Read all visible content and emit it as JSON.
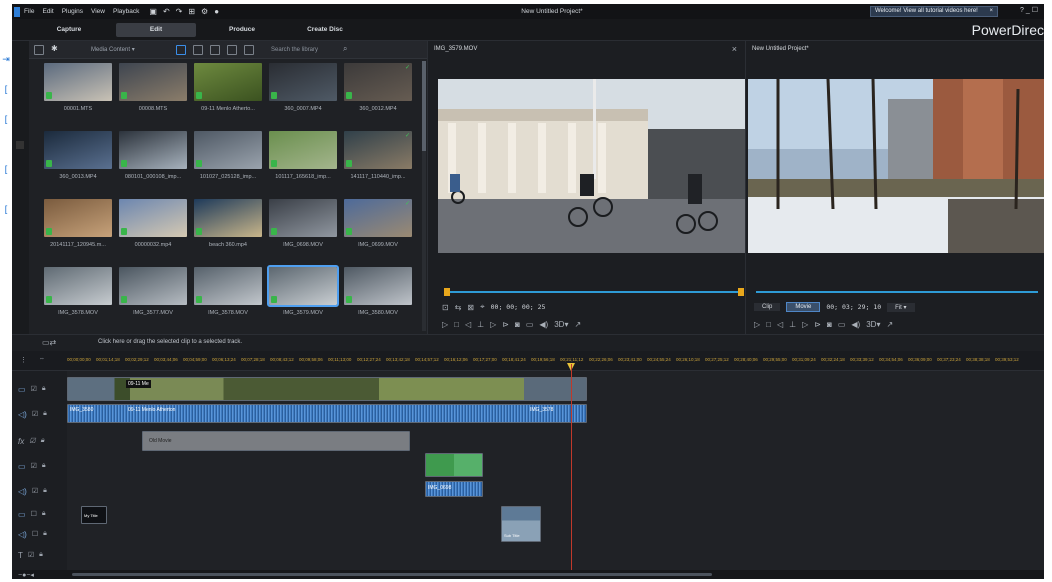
{
  "menu": {
    "items": [
      "File",
      "Edit",
      "Plugins",
      "View",
      "Playback"
    ],
    "window_title": "New Untitled Project*",
    "welcome": "Welcome! View all tutorial videos here!",
    "window_controls": "? _ ☐"
  },
  "modes": [
    "Capture",
    "Edit",
    "Produce",
    "Create Disc"
  ],
  "brand": "PowerDirec",
  "library": {
    "dropdown": "Media Content",
    "search_placeholder": "Search the library",
    "items": [
      {
        "label": "00001.MTS",
        "colors": [
          "#5b6a7e",
          "#c9c2b5"
        ]
      },
      {
        "label": "00008.MTS",
        "colors": [
          "#3e4550",
          "#8b7d6a"
        ]
      },
      {
        "label": "09-11 Menlo Atherto...",
        "colors": [
          "#6e8a3f",
          "#3b5220"
        ]
      },
      {
        "label": "360_0007.MP4",
        "colors": [
          "#2a2d33",
          "#4f5a66"
        ]
      },
      {
        "label": "360_0012.MP4",
        "colors": [
          "#3c3a3a",
          "#665c52"
        ]
      },
      {
        "label": "360_0013.MP4",
        "colors": [
          "#1b2a3c",
          "#5a7090"
        ]
      },
      {
        "label": "080101_000108_imp...",
        "colors": [
          "#2c333c",
          "#a7b2bd"
        ]
      },
      {
        "label": "101027_025128_imp...",
        "colors": [
          "#4e5864",
          "#9aa3ad"
        ]
      },
      {
        "label": "101117_165618_imp...",
        "colors": [
          "#6a8f4e",
          "#a4b58d"
        ]
      },
      {
        "label": "141117_110440_imp...",
        "colors": [
          "#30404a",
          "#8a7b66"
        ]
      },
      {
        "label": "20141117_120945.m...",
        "colors": [
          "#7a5b3e",
          "#c7a27a"
        ]
      },
      {
        "label": "00000032.mp4",
        "colors": [
          "#6c86b0",
          "#d5c9b2"
        ]
      },
      {
        "label": "beach 360.mp4",
        "colors": [
          "#1e3a5a",
          "#c9b68a"
        ]
      },
      {
        "label": "IMG_0698.MOV",
        "colors": [
          "#3a3f47",
          "#9097a0"
        ]
      },
      {
        "label": "IMG_0699.MOV",
        "colors": [
          "#4d6a9a",
          "#9b8a72"
        ]
      },
      {
        "label": "IMG_3578.MOV",
        "colors": [
          "#5f6a73",
          "#c7ccd0"
        ]
      },
      {
        "label": "IMG_3577.MOV",
        "colors": [
          "#4b5660",
          "#b6bcc2"
        ]
      },
      {
        "label": "IMG_3578.MOV",
        "colors": [
          "#56616b",
          "#c2c7cc"
        ]
      },
      {
        "label": "IMG_3579.MOV",
        "colors": [
          "#5c6770",
          "#c9ced2"
        ]
      },
      {
        "label": "IMG_3580.MOV",
        "colors": [
          "#4f5963",
          "#bfc4ca"
        ]
      }
    ]
  },
  "preview_left": {
    "title": "IMG_3579.MOV",
    "timecode": "00; 00; 00; 25"
  },
  "preview_right": {
    "title": "New Untitled Project*",
    "seg_clip": "Clip",
    "seg_movie": "Movie",
    "timecode": "00; 03; 29; 10",
    "fit": "Fit"
  },
  "timeline": {
    "hint": "Click here or drag the selected clip to a selected track.",
    "ruler": [
      "00;00;00;00",
      "00;01;14;18",
      "00;02;29;12",
      "00;03;44;06",
      "00;04;59;00",
      "00;06;13;24",
      "00;07;28;18",
      "00;08;43;12",
      "00;09;58;06",
      "00;11;13;00",
      "00;12;27;24",
      "00;13;42;18",
      "00;14;57;12",
      "00;16;12;06",
      "00;17;27;00",
      "00;18;41;24",
      "00;19;56;18",
      "00;21;11;12",
      "00;22;26;06",
      "00;23;41;00",
      "00;24;55;24",
      "00;26;10;18",
      "00;27;25;12",
      "00;28;40;06",
      "00;29;55;00",
      "00;31;09;24",
      "00;32;24;18",
      "00;33;39;12",
      "00;34;54;06",
      "00;36;09;00",
      "00;37;23;24",
      "00;38;38;18",
      "00;39;53;12"
    ],
    "clip_title": "09-11 Me",
    "audio_labels": [
      "IMG_3580",
      "09-11 Menlo Atherton",
      "IMG_3578"
    ],
    "fx_label": "Old Movie",
    "pip_label": "IMG_0698",
    "title_clip_label": "My Title",
    "title_clip2_label": "Sub Title"
  }
}
